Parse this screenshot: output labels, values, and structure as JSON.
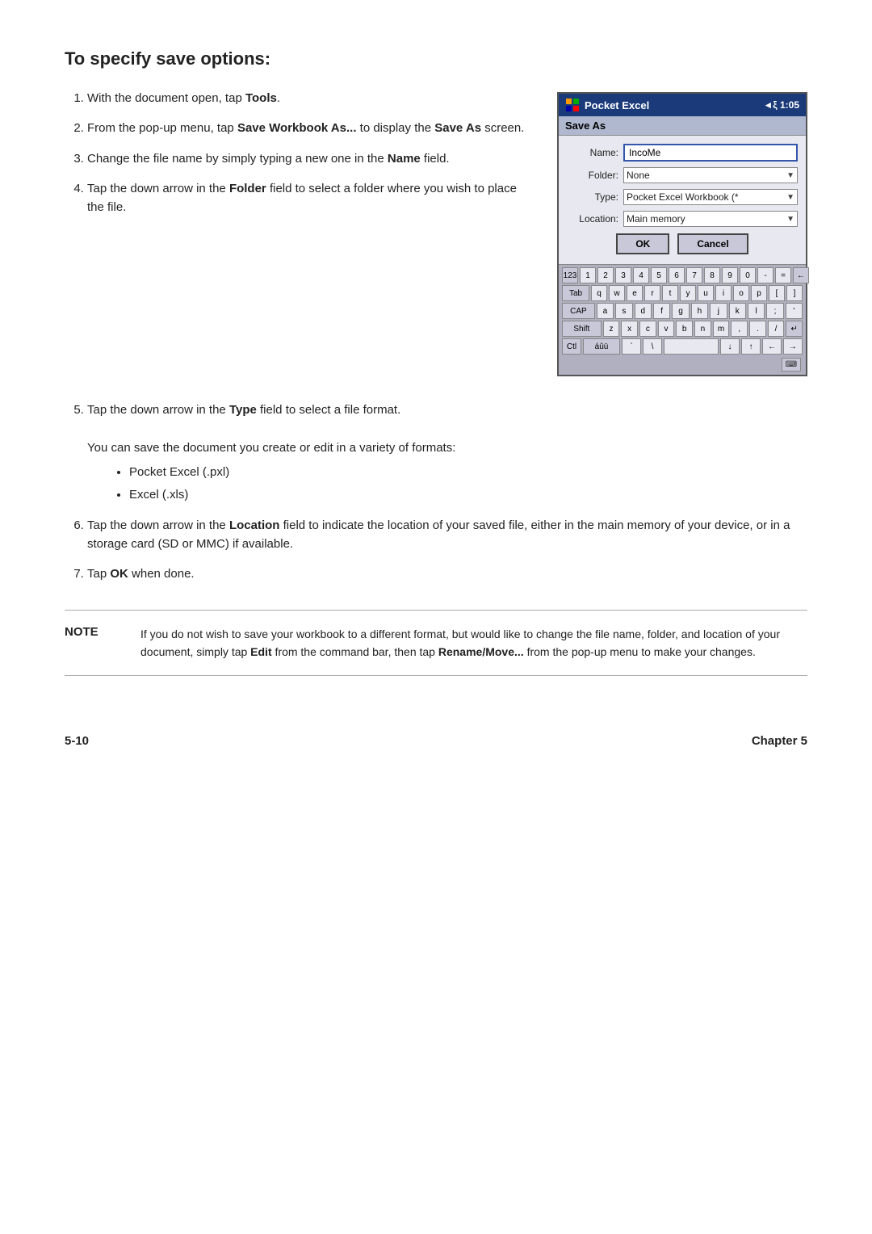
{
  "page": {
    "heading": "To specify save options:",
    "steps": [
      {
        "id": 1,
        "text": "With the document open, tap ",
        "bold": "Tools",
        "after": "."
      },
      {
        "id": 2,
        "text": "From the pop-up menu, tap ",
        "bold1": "Save Workbook As...",
        "mid": " to display the ",
        "bold2": "Save As",
        "after": " screen."
      },
      {
        "id": 3,
        "text": "Change the file name by simply typing a new one in the ",
        "bold": "Name",
        "after": " field."
      },
      {
        "id": 4,
        "text": "Tap the down arrow in the ",
        "bold": "Folder",
        "after": " field to select a folder where you wish to place the file."
      }
    ],
    "steps_below": [
      {
        "id": 5,
        "text": "Tap the down arrow in the ",
        "bold": "Type",
        "after": " field to select a file format."
      },
      {
        "id": 5,
        "subtext": "You can save the document you create or edit in a variety of formats:",
        "bullets": [
          "Pocket Excel (.pxl)",
          "Excel (.xls)"
        ]
      },
      {
        "id": 6,
        "text": "Tap the down arrow in the ",
        "bold": "Location",
        "after": " field to indicate the location of your saved file, either in the main memory of your device, or in a storage card (SD or MMC) if available."
      },
      {
        "id": 7,
        "text": "Tap ",
        "bold": "OK",
        "after": " when done."
      }
    ],
    "note": {
      "label": "NOTE",
      "text": "If you do not wish to save your workbook to a different format, but would like to change the file name, folder, and location of your document, simply tap Edit from the command bar, then tap Rename/Move... from the pop-up menu to make your changes.",
      "bold_edit": "Edit",
      "bold_rename": "Rename/Move..."
    },
    "footer": {
      "left": "5-10",
      "right": "Chapter 5"
    }
  },
  "screenshot": {
    "titlebar": {
      "app": "Pocket Excel",
      "time": "◄ξ 1:05"
    },
    "saveas_label": "Save As",
    "form": {
      "name_label": "Name:",
      "name_value": "IncoMe",
      "folder_label": "Folder:",
      "folder_value": "None",
      "type_label": "Type:",
      "type_value": "Pocket Excel Workbook (*",
      "location_label": "Location:",
      "location_value": "Main memory"
    },
    "buttons": {
      "ok": "OK",
      "cancel": "Cancel"
    },
    "keyboard": {
      "rows": [
        [
          "123",
          "1",
          "2",
          "3",
          "4",
          "5",
          "6",
          "7",
          "8",
          "9",
          "0",
          "-",
          "=",
          "←"
        ],
        [
          "Tab",
          "q",
          "w",
          "e",
          "r",
          "t",
          "y",
          "u",
          "i",
          "o",
          "p",
          "[",
          "]"
        ],
        [
          "CAP",
          "a",
          "s",
          "d",
          "f",
          "g",
          "h",
          "j",
          "k",
          "l",
          ";",
          "'"
        ],
        [
          "Shift",
          "z",
          "x",
          "c",
          "v",
          "b",
          "n",
          "m",
          ",",
          ".",
          "/",
          "↵"
        ],
        [
          "Ctl",
          "áûü",
          "`",
          "\\",
          "↓",
          "↑",
          "←",
          "→"
        ]
      ]
    }
  }
}
